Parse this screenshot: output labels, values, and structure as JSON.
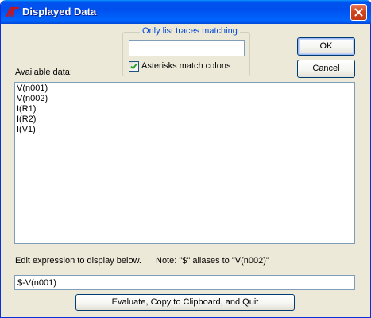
{
  "window": {
    "title": "Displayed Data",
    "icon": "ltspice-logo-icon",
    "title_bar_color": "#0054e3"
  },
  "filter": {
    "group_label": "Only list traces matching",
    "value": "",
    "asterisks_checkbox_label": "Asterisks match colons",
    "asterisks_checked": true
  },
  "buttons": {
    "ok": "OK",
    "cancel": "Cancel",
    "evaluate": "Evaluate, Copy to Clipboard, and Quit"
  },
  "available": {
    "label": "Available data:",
    "items": [
      "V(n001)",
      "V(n002)",
      "I(R1)",
      "I(R2)",
      "I(V1)"
    ]
  },
  "expression": {
    "edit_label": "Edit expression to display below.",
    "note": "Note: \"$\" aliases to \"V(n002)\"",
    "value": "$-V(n001)"
  }
}
